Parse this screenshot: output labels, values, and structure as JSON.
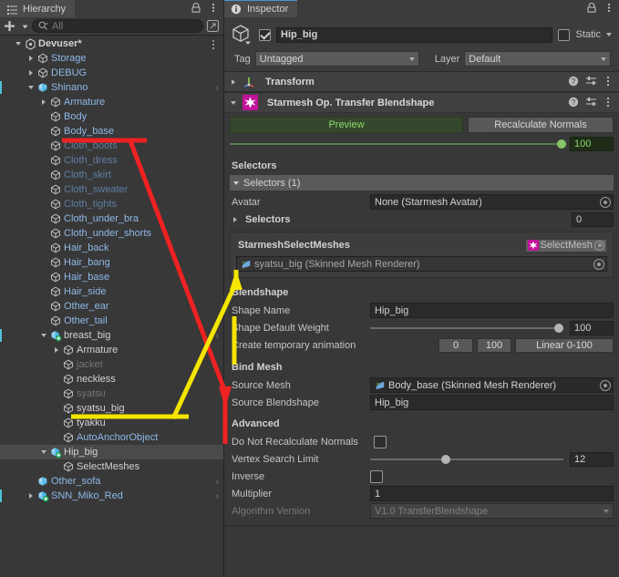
{
  "hierarchy": {
    "tab_label": "Hierarchy",
    "search_placeholder": "All",
    "scene_name": "Devuser*",
    "items": [
      {
        "label": "Storage",
        "depth": 2,
        "expand": "closed",
        "icon": "gameobject",
        "style": "blue"
      },
      {
        "label": "DEBUG",
        "depth": 2,
        "expand": "closed",
        "icon": "gameobject",
        "style": "blue"
      },
      {
        "label": "Shinano",
        "depth": 2,
        "expand": "open",
        "icon": "prefab",
        "style": "blue",
        "bar": true,
        "chevron": true
      },
      {
        "label": "Armature",
        "depth": 3,
        "expand": "closed",
        "icon": "gameobject",
        "style": "blue"
      },
      {
        "label": "Body",
        "depth": 3,
        "expand": "none",
        "icon": "gameobject",
        "style": "blue"
      },
      {
        "label": "Body_base",
        "depth": 3,
        "expand": "none",
        "icon": "gameobject",
        "style": "blue"
      },
      {
        "label": "Cloth_boots",
        "depth": 3,
        "expand": "none",
        "icon": "gameobject",
        "style": "dimblue"
      },
      {
        "label": "Cloth_dress",
        "depth": 3,
        "expand": "none",
        "icon": "gameobject",
        "style": "dimblue"
      },
      {
        "label": "Cloth_skirt",
        "depth": 3,
        "expand": "none",
        "icon": "gameobject",
        "style": "dimblue"
      },
      {
        "label": "Cloth_sweater",
        "depth": 3,
        "expand": "none",
        "icon": "gameobject",
        "style": "dimblue"
      },
      {
        "label": "Cloth_tights",
        "depth": 3,
        "expand": "none",
        "icon": "gameobject",
        "style": "dimblue"
      },
      {
        "label": "Cloth_under_bra",
        "depth": 3,
        "expand": "none",
        "icon": "gameobject",
        "style": "blue"
      },
      {
        "label": "Cloth_under_shorts",
        "depth": 3,
        "expand": "none",
        "icon": "gameobject",
        "style": "blue"
      },
      {
        "label": "Hair_back",
        "depth": 3,
        "expand": "none",
        "icon": "gameobject",
        "style": "blue"
      },
      {
        "label": "Hair_bang",
        "depth": 3,
        "expand": "none",
        "icon": "gameobject",
        "style": "blue"
      },
      {
        "label": "Hair_base",
        "depth": 3,
        "expand": "none",
        "icon": "gameobject",
        "style": "blue"
      },
      {
        "label": "Hair_side",
        "depth": 3,
        "expand": "none",
        "icon": "gameobject",
        "style": "blue"
      },
      {
        "label": "Other_ear",
        "depth": 3,
        "expand": "none",
        "icon": "gameobject",
        "style": "blue"
      },
      {
        "label": "Other_tail",
        "depth": 3,
        "expand": "none",
        "icon": "gameobject",
        "style": "blue"
      },
      {
        "label": "breast_big",
        "depth": 3,
        "expand": "open",
        "icon": "prefab-variant",
        "style": "white",
        "bar": true,
        "chevron": true
      },
      {
        "label": "Armature",
        "depth": 4,
        "expand": "closed",
        "icon": "gameobject",
        "style": "white"
      },
      {
        "label": "jacket",
        "depth": 4,
        "expand": "none",
        "icon": "gameobject",
        "style": "dim"
      },
      {
        "label": "neckless",
        "depth": 4,
        "expand": "none",
        "icon": "gameobject",
        "style": "white"
      },
      {
        "label": "syatsu",
        "depth": 4,
        "expand": "none",
        "icon": "gameobject",
        "style": "dim"
      },
      {
        "label": "syatsu_big",
        "depth": 4,
        "expand": "none",
        "icon": "gameobject",
        "style": "white"
      },
      {
        "label": "tyakku",
        "depth": 4,
        "expand": "none",
        "icon": "gameobject",
        "style": "white"
      },
      {
        "label": "AutoAnchorObject",
        "depth": 4,
        "expand": "none",
        "icon": "gameobject",
        "style": "blue"
      },
      {
        "label": "Hip_big",
        "depth": 3,
        "expand": "open",
        "icon": "prefab-variant",
        "style": "white",
        "selected": true
      },
      {
        "label": "SelectMeshes",
        "depth": 4,
        "expand": "none",
        "icon": "gameobject",
        "style": "white"
      },
      {
        "label": "Other_sofa",
        "depth": 2,
        "expand": "none",
        "icon": "prefab",
        "style": "blue",
        "chevron": true
      },
      {
        "label": "SNN_Miko_Red",
        "depth": 2,
        "expand": "closed",
        "icon": "prefab-variant",
        "style": "blue",
        "bar": true,
        "chevron": true
      }
    ]
  },
  "inspector": {
    "tab_label": "Inspector",
    "gameobject": {
      "name": "Hip_big",
      "enabled": true,
      "static_label": "Static",
      "static_checked": false,
      "tag_label": "Tag",
      "tag_value": "Untagged",
      "layer_label": "Layer",
      "layer_value": "Default"
    },
    "transform_component": {
      "title": "Transform"
    },
    "starmesh_component": {
      "title": "Starmesh Op. Transfer Blendshape",
      "preview_button": "Preview",
      "recalc_button": "Recalculate Normals",
      "preview_weight": "100",
      "selectors_section": "Selectors",
      "selectors_foldout": "Selectors (1)",
      "avatar_label": "Avatar",
      "avatar_value": "None (Starmesh Avatar)",
      "selectors_label": "Selectors",
      "selectors_count": "0",
      "select_meshes_label": "StarmeshSelectMeshes",
      "select_meshes_value": "SelectMesh",
      "select_meshes_target": "syatsu_big (Skinned Mesh Renderer)",
      "blendshape_section": "Blendshape",
      "shape_name_label": "Shape Name",
      "shape_name_value": "Hip_big",
      "shape_weight_label": "Shape Default Weight",
      "shape_weight_value": "100",
      "temp_anim_label": "Create temporary animation",
      "temp_anim_btn_0": "0",
      "temp_anim_btn_100": "100",
      "temp_anim_btn_linear": "Linear 0-100",
      "bind_mesh_section": "Bind Mesh",
      "source_mesh_label": "Source Mesh",
      "source_mesh_value": "Body_base (Skinned Mesh Renderer)",
      "source_blendshape_label": "Source Blendshape",
      "source_blendshape_value": "Hip_big",
      "advanced_section": "Advanced",
      "no_recalc_label": "Do Not Recalculate Normals",
      "no_recalc_checked": false,
      "vertex_limit_label": "Vertex Search Limit",
      "vertex_limit_value": "12",
      "inverse_label": "Inverse",
      "inverse_checked": false,
      "multiplier_label": "Multiplier",
      "multiplier_value": "1",
      "algorithm_label": "Algorithm Version",
      "algorithm_value": "V1.0 TransferBlendshape"
    }
  },
  "annotations": {
    "red_color": "#ee2222",
    "yellow_color": "#f5e500"
  }
}
